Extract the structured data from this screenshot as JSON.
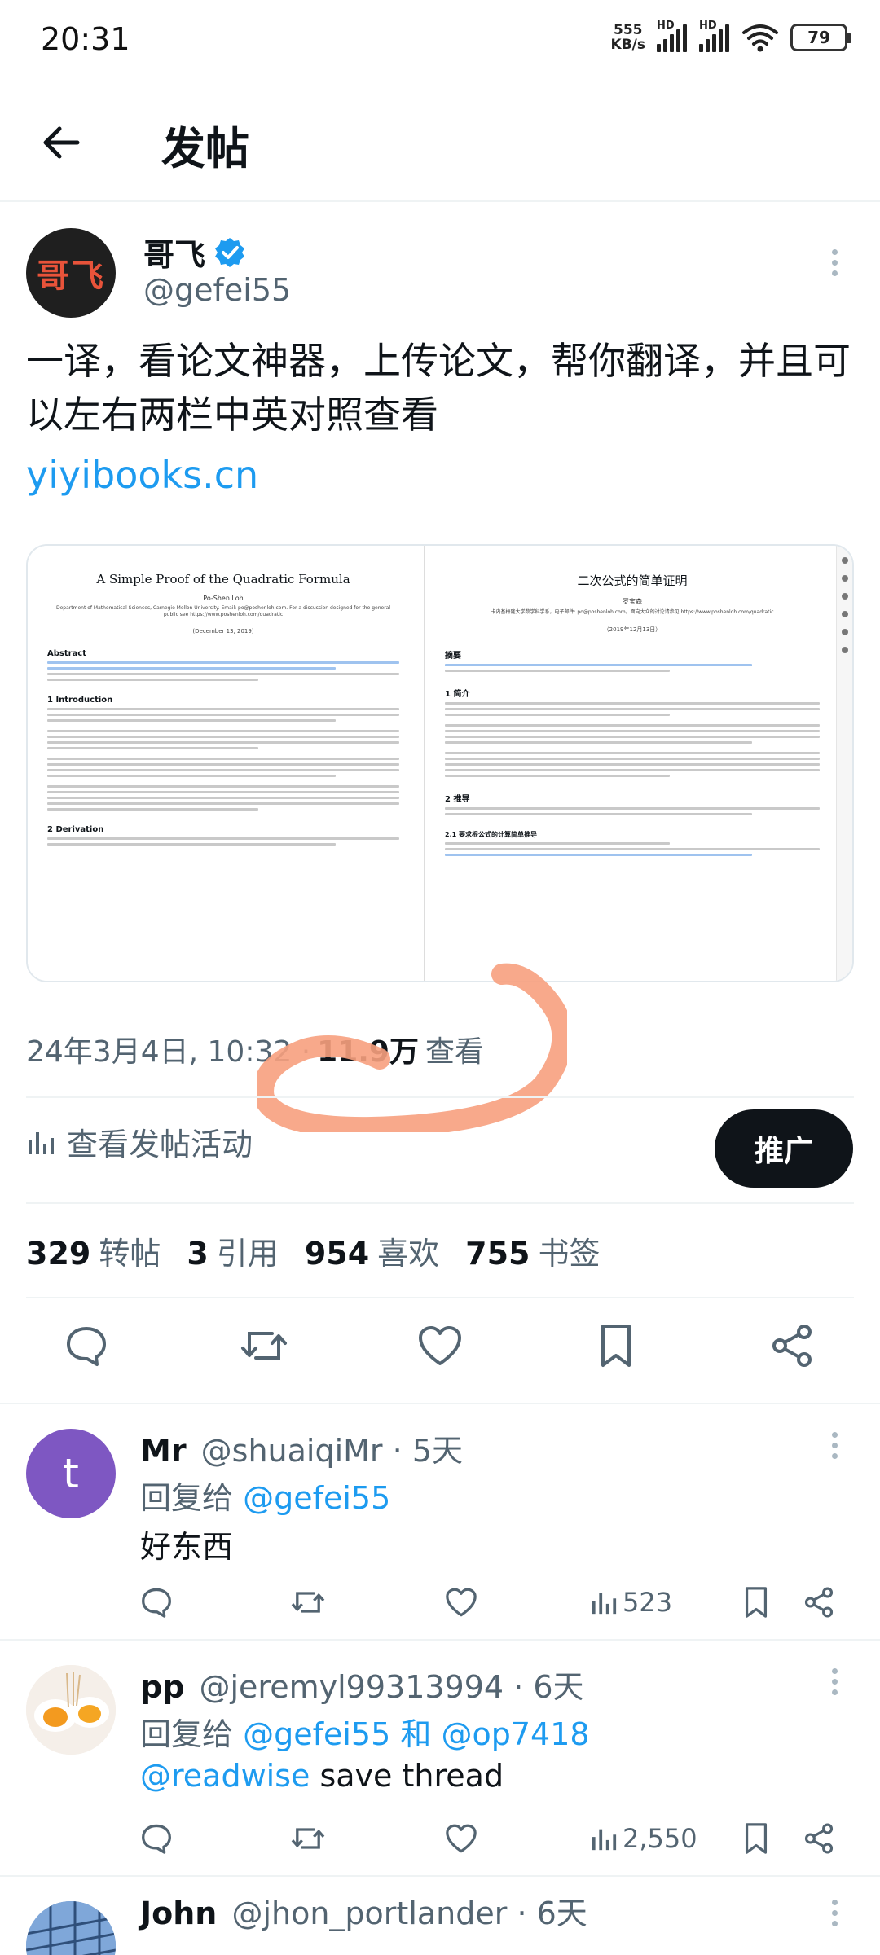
{
  "status_bar": {
    "time": "20:31",
    "net_speed_value": "555",
    "net_speed_unit": "KB/s",
    "hd_label": "HD",
    "battery": "79"
  },
  "header": {
    "title": "发帖"
  },
  "tweet": {
    "author_name": "哥飞",
    "author_handle": "@gefei55",
    "avatar_text": "哥飞",
    "text": "一译，看论文神器，上传论文，帮你翻译，并且可以左右两栏中英对照查看",
    "link": "yiyibooks.cn",
    "media": {
      "left_title": "A Simple Proof of the Quadratic Formula",
      "left_author": "Po-Shen Loh",
      "left_affiliation": "Department of Mathematical Sciences, Carnegie Mellon University. Email: po@poshenloh.com. For a discussion designed for the general public see https://www.poshenloh.com/quadratic",
      "left_date": "(December 13, 2019)",
      "left_abstract": "Abstract",
      "left_intro": "1    Introduction",
      "left_derivation": "2    Derivation",
      "right_title": "二次公式的简单证明",
      "right_author": "罗宝森",
      "right_affiliation": "卡内基梅隆大学数学科学系，电子邮件: po@poshenloh.com。面向大众的讨论请参见 https://www.poshenloh.com/quadratic",
      "right_date": "（2019年12月13日）",
      "right_abstract": "摘要",
      "right_intro": "1    简介",
      "right_derivation": "2    推导",
      "right_sub": "2.1    要求根公式的计算简单推导"
    },
    "timestamp": "24年3月4日, 10:32 ·",
    "views_count": "11.9万",
    "views_label": "查看",
    "activity_label": "查看发帖活动",
    "promote_label": "推广",
    "retweets_count": "329",
    "retweets_label": "转帖",
    "quotes_count": "3",
    "quotes_label": "引用",
    "likes_count": "954",
    "likes_label": "喜欢",
    "bookmarks_count": "755",
    "bookmarks_label": "书签"
  },
  "replies": [
    {
      "name": "Mr",
      "handle": "@shuaiqiMr",
      "time": "· 5天",
      "avatar_letter": "t",
      "reply_prefix": "回复给",
      "reply_to": "@gefei55",
      "reply_join": "",
      "reply_to2": "",
      "body_mention": "",
      "body": "好东西",
      "views": "523"
    },
    {
      "name": "pp",
      "handle": "@jeremyl99313994",
      "time": "· 6天",
      "reply_prefix": "回复给",
      "reply_to": "@gefei55",
      "reply_join": "和",
      "reply_to2": "@op7418",
      "body_mention": "@readwise",
      "body": "save thread",
      "views": "2,550"
    },
    {
      "name": "John",
      "handle": "@jhon_portlander",
      "time": "· 6天"
    }
  ],
  "colors": {
    "accent": "#1d9bf0",
    "text": "#0f1419",
    "muted": "#536471",
    "annotation": "#f7a07e",
    "avatar_reply1": "#7e57c2"
  }
}
